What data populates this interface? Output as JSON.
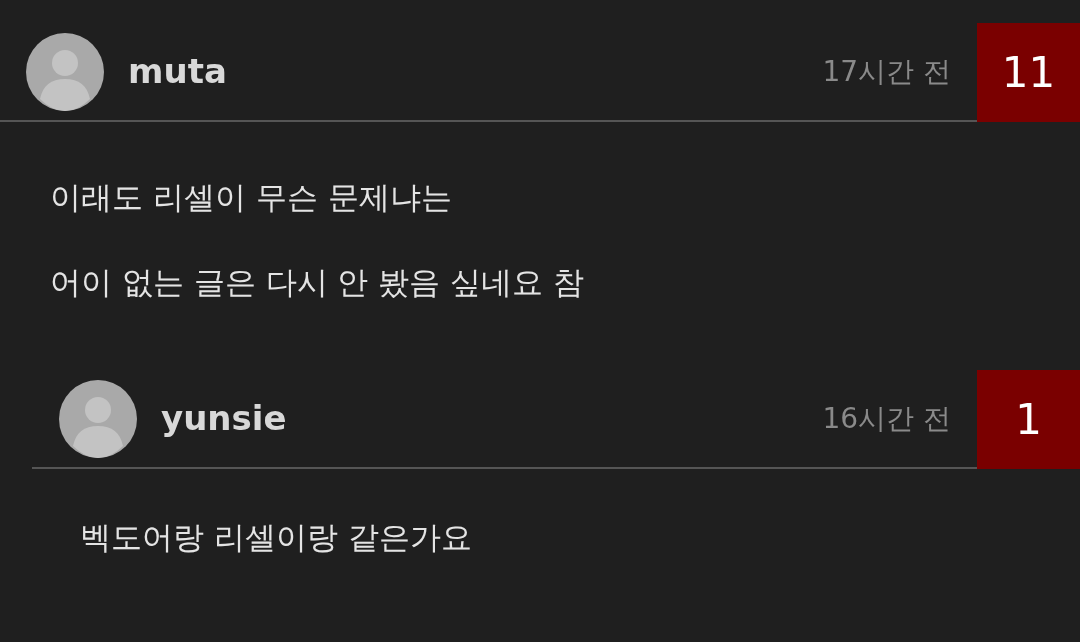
{
  "comments": [
    {
      "author": "muta",
      "time": "17시간 전",
      "votes": "11",
      "lines": [
        "이래도 리셀이 무슨 문제냐는",
        "어이 없는 글은 다시 안 봤음 싶네요 참"
      ],
      "replies": [
        {
          "author": "yunsie",
          "time": "16시간 전",
          "votes": "1",
          "lines": [
            "벡도어랑 리셀이랑 같은가요"
          ]
        }
      ]
    }
  ]
}
